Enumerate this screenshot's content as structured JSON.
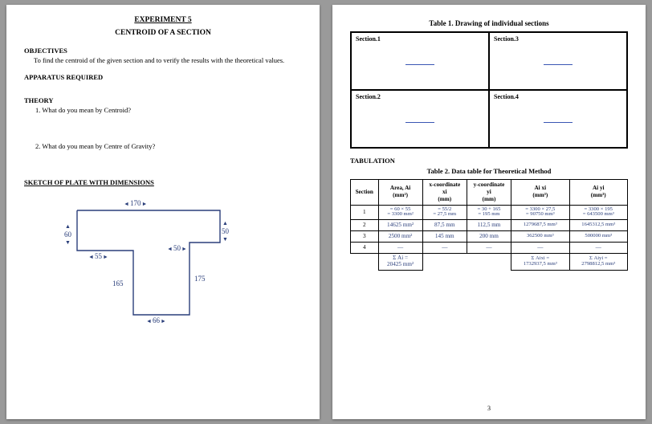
{
  "page1": {
    "experiment_title": "EXPERIMENT 5",
    "subtitle": "CENTROID OF A SECTION",
    "objectives_h": "OBJECTIVES",
    "objectives_text": "To find the centroid of the given section and to verify the results with the theoretical values.",
    "apparatus_h": "APPARATUS REQUIRED",
    "theory_h": "THEORY",
    "q1_no": "1.",
    "q1": "What do you mean by Centroid?",
    "q2_no": "2.",
    "q2": "What do you mean by Centre of Gravity?",
    "sketch_h": "SKETCH OF PLATE WITH DIMENSIONS",
    "dim_top": "170",
    "dim_right_upper": "50",
    "dim_left_upper": "60",
    "dim_left_lower": "165",
    "dim_mid_55": "55",
    "dim_mid_50": "50",
    "dim_right_175": "175",
    "dim_bottom": "66"
  },
  "page2": {
    "table1_title": "Table 1. Drawing of individual sections",
    "sec1": "Section.1",
    "sec2": "Section.2",
    "sec3": "Section.3",
    "sec4": "Section.4",
    "tabulation_h": "TABULATION",
    "table2_title": "Table 2. Data table for Theoretical Method",
    "headers": {
      "section": "Section",
      "area": "Area, Ai",
      "area_u": "(mm²)",
      "x": "x-coordinate",
      "x_sub": "xi",
      "x_u": "(mm)",
      "y": "y-coordinate",
      "y_sub": "yi",
      "y_u": "(mm)",
      "ax": "Ai xi",
      "ax_u": "(mm³)",
      "ay": "Ai yi",
      "ay_u": "(mm³)"
    },
    "rows": [
      {
        "n": "1",
        "area": "= 60 × 55\n= 3300 mm²",
        "x": "= 55/2\n= 27,5 mm",
        "y": "= 30 + 165\n= 195 mm",
        "ax": "= 3300 × 27,5\n= 90750 mm³",
        "ay": "= 3300 × 195\n= 643500 mm³"
      },
      {
        "n": "2",
        "area": "14625 mm²",
        "x": "87,5 mm",
        "y": "112,5 mm",
        "ax": "1279687,5 mm³",
        "ay": "1645312,5 mm³"
      },
      {
        "n": "3",
        "area": "2500 mm²",
        "x": "145 mm",
        "y": "200 mm",
        "ax": "362500 mm³",
        "ay": "500000 mm³"
      },
      {
        "n": "4",
        "area": "—",
        "x": "—",
        "y": "—",
        "ax": "—",
        "ay": "—"
      }
    ],
    "totals": {
      "sumA_lbl": "Σ Ai =",
      "sumA": "20425 mm²",
      "sumAx_lbl": "Σ Aixi =",
      "sumAx": "1732937,5 mm³",
      "sumAy_lbl": "Σ Aiyi =",
      "sumAy": "2798812,5 mm³"
    },
    "page_no": "3"
  },
  "chart_data": {
    "type": "table",
    "title": "Table 2. Data table for Theoretical Method",
    "columns": [
      "Section",
      "Area Ai (mm²)",
      "xi (mm)",
      "yi (mm)",
      "Ai·xi (mm³)",
      "Ai·yi (mm³)"
    ],
    "rows": [
      [
        "1",
        3300,
        27.5,
        195,
        90750,
        643500
      ],
      [
        "2",
        14625,
        87.5,
        112.5,
        1279687.5,
        1645312.5
      ],
      [
        "3",
        2500,
        145,
        200,
        362500,
        500000
      ],
      [
        "4",
        null,
        null,
        null,
        null,
        null
      ]
    ],
    "totals": {
      "sum_A": 20425,
      "sum_Ax": 1732937.5,
      "sum_Ay": 2798812.5
    },
    "sketch_dimensions_mm": {
      "top_width": 170,
      "upper_right_height": 50,
      "upper_left_height": 60,
      "left_height": 165,
      "step_55": 55,
      "step_50": 50,
      "right_height": 175,
      "bottom_width": 66
    }
  }
}
